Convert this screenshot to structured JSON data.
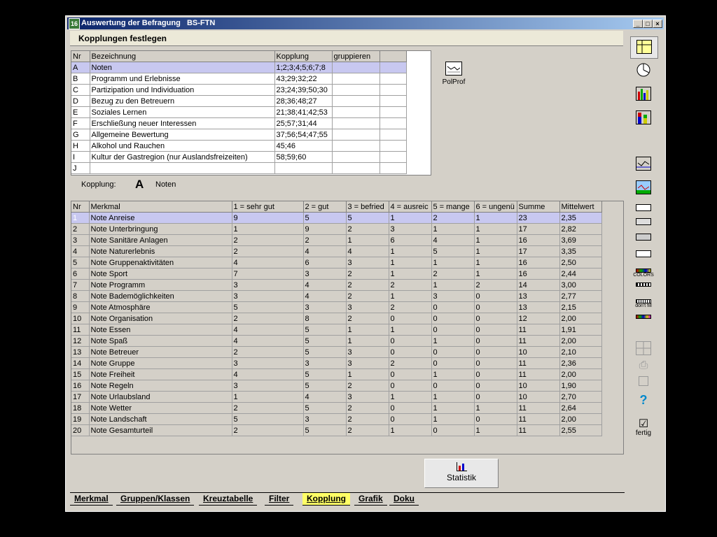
{
  "window": {
    "title": "Auswertung der Befragung",
    "subtitle": "BS-FTN",
    "app_icon": "16"
  },
  "title_buttons": {
    "minimize": "_",
    "maximize": "□",
    "close": "×"
  },
  "section_title": "Kopplungen festlegen",
  "top_grid": {
    "headers": [
      "Nr",
      "Bezeichnung",
      "Kopplung",
      "gruppieren",
      ""
    ],
    "rows": [
      [
        "A",
        "Noten",
        "1;2;3;4;5;6;7;8",
        ""
      ],
      [
        "B",
        "Programm und Erlebnisse",
        "43;29;32;22",
        ""
      ],
      [
        "C",
        "Partizipation und Individuation",
        "23;24;39;50;30",
        ""
      ],
      [
        "D",
        "Bezug zu den Betreuern",
        "28;36;48;27",
        ""
      ],
      [
        "E",
        "Soziales Lernen",
        "21;38;41;42;53",
        ""
      ],
      [
        "F",
        "Erschließung neuer Interessen",
        "25;57;31;44",
        ""
      ],
      [
        "G",
        "Allgemeine Bewertung",
        "37;56;54;47;55",
        ""
      ],
      [
        "H",
        "Alkohol und Rauchen",
        "45;46",
        ""
      ],
      [
        "I",
        "Kultur der Gastregion (nur Auslandsfreizeiten)",
        "58;59;60",
        ""
      ],
      [
        "J",
        "",
        "",
        ""
      ]
    ]
  },
  "polprof": {
    "label": "PolProf",
    "icon": "profile-chart-icon"
  },
  "kopplung_info": {
    "label": "Kopplung:",
    "letter": "A",
    "name": "Noten"
  },
  "main_grid": {
    "headers": [
      "Nr",
      "Merkmal",
      "1 = sehr gut",
      "2 = gut",
      "3 = befried",
      "4 = ausreic",
      "5 = mange",
      "6 = ungenü",
      "Summe",
      "Mittelwert"
    ],
    "rows": [
      [
        "1",
        "Note Anreise",
        "9",
        "5",
        "5",
        "1",
        "2",
        "1",
        "23",
        "2,35"
      ],
      [
        "2",
        "Note Unterbringung",
        "1",
        "9",
        "2",
        "3",
        "1",
        "1",
        "17",
        "2,82"
      ],
      [
        "3",
        "Note Sanitäre Anlagen",
        "2",
        "2",
        "1",
        "6",
        "4",
        "1",
        "16",
        "3,69"
      ],
      [
        "4",
        "Note Naturerlebnis",
        "2",
        "4",
        "4",
        "1",
        "5",
        "1",
        "17",
        "3,35"
      ],
      [
        "5",
        "Note Gruppenaktivitäten",
        "4",
        "6",
        "3",
        "1",
        "1",
        "1",
        "16",
        "2,50"
      ],
      [
        "6",
        "Note Sport",
        "7",
        "3",
        "2",
        "1",
        "2",
        "1",
        "16",
        "2,44"
      ],
      [
        "7",
        "Note Programm",
        "3",
        "4",
        "2",
        "2",
        "1",
        "2",
        "14",
        "3,00"
      ],
      [
        "8",
        "Note Bademöglichkeiten",
        "3",
        "4",
        "2",
        "1",
        "3",
        "0",
        "13",
        "2,77"
      ],
      [
        "9",
        "Note Atmosphäre",
        "5",
        "3",
        "3",
        "2",
        "0",
        "0",
        "13",
        "2,15"
      ],
      [
        "10",
        "Note Organisation",
        "2",
        "8",
        "2",
        "0",
        "0",
        "0",
        "12",
        "2,00"
      ],
      [
        "11",
        "Note Essen",
        "4",
        "5",
        "1",
        "1",
        "0",
        "0",
        "11",
        "1,91"
      ],
      [
        "12",
        "Note Spaß",
        "4",
        "5",
        "1",
        "0",
        "1",
        "0",
        "11",
        "2,00"
      ],
      [
        "13",
        "Note Betreuer",
        "2",
        "5",
        "3",
        "0",
        "0",
        "0",
        "10",
        "2,10"
      ],
      [
        "14",
        "Note Gruppe",
        "3",
        "3",
        "3",
        "2",
        "0",
        "0",
        "11",
        "2,36"
      ],
      [
        "15",
        "Note Freiheit",
        "4",
        "5",
        "1",
        "0",
        "1",
        "0",
        "11",
        "2,00"
      ],
      [
        "16",
        "Note Regeln",
        "3",
        "5",
        "2",
        "0",
        "0",
        "0",
        "10",
        "1,90"
      ],
      [
        "17",
        "Note Urlaubsland",
        "1",
        "4",
        "3",
        "1",
        "1",
        "0",
        "10",
        "2,70"
      ],
      [
        "18",
        "Note Wetter",
        "2",
        "5",
        "2",
        "0",
        "1",
        "1",
        "11",
        "2,64"
      ],
      [
        "19",
        "Note Landschaft",
        "5",
        "3",
        "2",
        "0",
        "1",
        "0",
        "11",
        "2,00"
      ],
      [
        "20",
        "Note Gesamturteil",
        "2",
        "5",
        "2",
        "1",
        "0",
        "1",
        "11",
        "2,55"
      ]
    ]
  },
  "statistik_button": {
    "label": "Statistik",
    "icon": "statistics-chart-icon"
  },
  "tabs": [
    "Merkmal",
    "Gruppen/Klassen",
    "Kreuztabelle",
    "Filter",
    "Kopplung",
    "Grafik",
    "Doku"
  ],
  "active_tab": "Kopplung",
  "sidebar": {
    "buttons": [
      "table-view-icon",
      "pie-chart-icon",
      "bar-chart-icon",
      "stacked-bar-icon",
      "line-profile-icon",
      "color-profile-icon",
      "car-icon-1",
      "car-icon-2",
      "car-icon-3",
      "car-icon-4",
      "colors-icon",
      "pattern-icon",
      "dont-fill-icon",
      "color-strip-icon",
      "grid-icon",
      "print-icon",
      "save-icon",
      "help-icon",
      "done-icon"
    ],
    "colors_label": "COLORS",
    "dontfill_label": "don't fill",
    "help_label": "?",
    "done_label": "fertig"
  },
  "colors": {
    "title_start": "#0a246a",
    "title_end": "#a6caf0",
    "selection": "#c8c8f0",
    "active_tab": "#ffff66"
  }
}
